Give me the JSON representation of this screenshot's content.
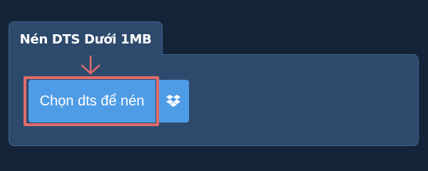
{
  "tab": {
    "title": "Nén DTS Dưới 1MB"
  },
  "upload": {
    "choose_label": "Chọn dts để nén",
    "dropbox_icon": "dropbox-icon"
  },
  "colors": {
    "page_background": "#142338",
    "panel_background": "#2d4a6d",
    "button_background": "#4f9ce6",
    "highlight": "#e06b6b"
  }
}
